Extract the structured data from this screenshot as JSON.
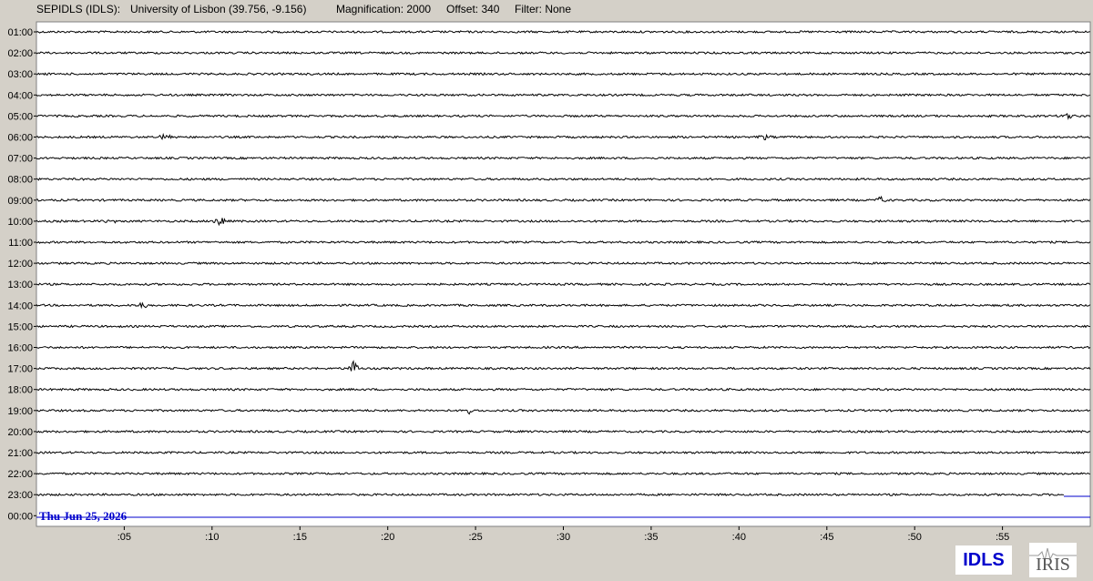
{
  "header": {
    "station": "SEPIDLS (IDLS):",
    "location": "University of Lisbon (39.756, -9.156)",
    "magnification": "Magnification: 2000",
    "offset": "Offset: 340",
    "filter": "Filter: None"
  },
  "logos": {
    "idls": "IDLS",
    "iris": "IRIS"
  },
  "colors": {
    "background": "#d4d0c8",
    "plot": "#ffffff",
    "trace": "#000000",
    "date": "#0000cc",
    "current_line": "#0000cc"
  },
  "chart_data": {
    "type": "line",
    "date_label": "Thu Jun 25, 2026",
    "hour_labels": [
      "01:00",
      "02:00",
      "03:00",
      "04:00",
      "05:00",
      "06:00",
      "07:00",
      "08:00",
      "09:00",
      "10:00",
      "11:00",
      "12:00",
      "13:00",
      "14:00",
      "15:00",
      "16:00",
      "17:00",
      "18:00",
      "19:00",
      "20:00",
      "21:00",
      "22:00",
      "23:00",
      "00:00"
    ],
    "minute_ticks": [
      ":05",
      ":10",
      ":15",
      ":20",
      ":25",
      ":30",
      ":35",
      ":40",
      ":45",
      ":50",
      ":55"
    ],
    "minute_values": [
      5,
      10,
      15,
      20,
      25,
      30,
      35,
      40,
      45,
      50,
      55
    ],
    "xlim": [
      0,
      60
    ],
    "trace_end_minutes": [
      60,
      60,
      60,
      60,
      60,
      60,
      60,
      60,
      60,
      60,
      60,
      60,
      60,
      60,
      60,
      60,
      60,
      60,
      60,
      60,
      60,
      60,
      58.5,
      0
    ],
    "events": [
      {
        "hour": 6,
        "minute": 7.4,
        "amplitude": 5
      },
      {
        "hour": 6,
        "minute": 41.5,
        "amplitude": 3
      },
      {
        "hour": 9,
        "minute": 48,
        "amplitude": 4
      },
      {
        "hour": 10,
        "minute": 4.3,
        "amplitude": 5
      },
      {
        "hour": 10,
        "minute": 10.4,
        "amplitude": 8
      },
      {
        "hour": 14,
        "minute": 6,
        "amplitude": 4
      },
      {
        "hour": 17,
        "minute": 18,
        "amplitude": 9
      },
      {
        "hour": 19,
        "minute": 24.6,
        "amplitude": 3
      },
      {
        "hour": 5,
        "minute": 58.8,
        "amplitude": 4
      }
    ]
  }
}
